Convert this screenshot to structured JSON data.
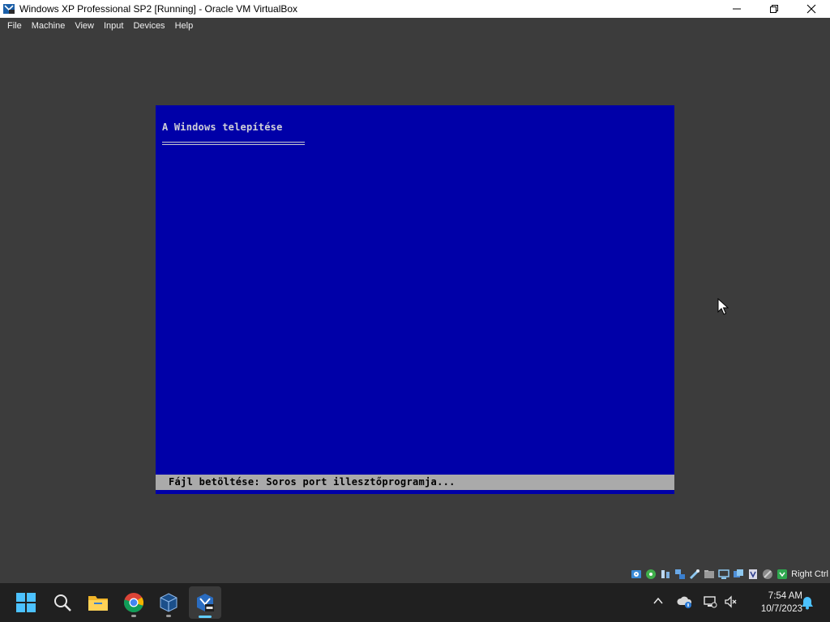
{
  "window": {
    "title": "Windows XP Professional SP2 [Running] - Oracle VM VirtualBox",
    "icon": "virtualbox-xp-icon",
    "controls": [
      "minimize-icon",
      "maximize-icon",
      "close-icon"
    ]
  },
  "menu": {
    "items": [
      {
        "label": "File"
      },
      {
        "label": "Machine"
      },
      {
        "label": "View"
      },
      {
        "label": "Input"
      },
      {
        "label": "Devices"
      },
      {
        "label": "Help"
      }
    ]
  },
  "guest": {
    "setup_title": "A Windows telepítése",
    "status_text": "Fájl betöltése: Soros port illesztőprogramja...",
    "colors": {
      "background": "#0000a8",
      "status_bar": "#aaaaaa",
      "text": "#d0d0d8"
    }
  },
  "vbox_status": {
    "icons": [
      "hard-disk-icon",
      "optical-drive-icon",
      "audio-icon",
      "network-icon",
      "usb-icon",
      "shared-folders-icon",
      "display-icon",
      "video-capture-icon",
      "cpu-icon",
      "mouse-integration-icon",
      "host-key-icon"
    ],
    "host_key": "Right Ctrl"
  },
  "taskbar": {
    "apps": [
      "windows-start-icon",
      "search-icon",
      "file-explorer-icon",
      "chrome-icon",
      "virtualbox-manager-icon",
      "virtualbox-vm-icon"
    ],
    "tray_icons": [
      "chevron-up-icon",
      "onedrive-icon",
      "network-icon",
      "volume-muted-icon"
    ],
    "time": "7:54 AM",
    "date": "10/7/2023",
    "notification": "bell-icon"
  }
}
